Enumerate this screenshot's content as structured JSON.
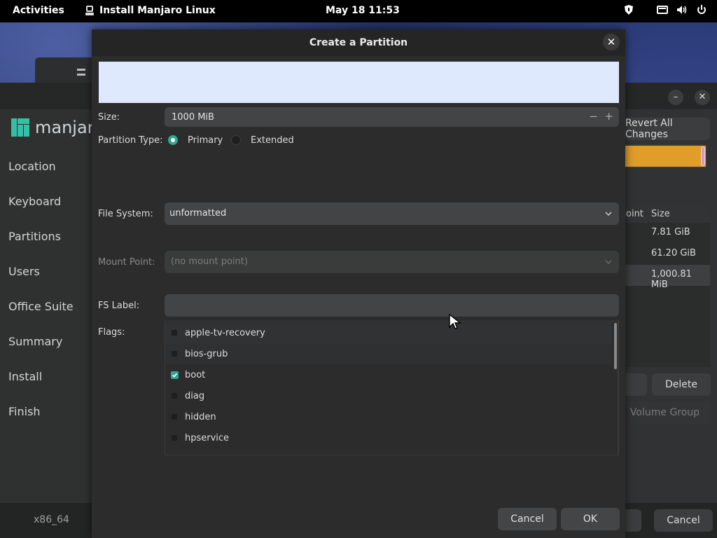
{
  "topbar": {
    "activities": "Activities",
    "app_name": "Install Manjaro Linux",
    "clock": "May 18  11:53"
  },
  "installer": {
    "logo_text": "manjaro",
    "nav": [
      "Location",
      "Keyboard",
      "Partitions",
      "Users",
      "Office Suite",
      "Summary",
      "Install",
      "Finish"
    ],
    "revert_label": "Revert All Changes",
    "table_headers": [
      "oint",
      "Size"
    ],
    "table_sizes": [
      "7.81 GiB",
      "61.20 GiB",
      "1,000.81 MiB"
    ],
    "delete_label": "Delete",
    "volume_group_label": "Volume Group",
    "cancel_label": "Cancel",
    "arch": "x86_64"
  },
  "dialog": {
    "title": "Create a Partition",
    "size_label": "Size:",
    "size_value": "1000 MiB",
    "partition_type_label": "Partition Type:",
    "primary_label": "Primary",
    "extended_label": "Extended",
    "filesystem_label": "File System:",
    "filesystem_value": "unformatted",
    "mount_label": "Mount Point:",
    "mount_value": "(no mount point)",
    "fslabel_label": "FS Label:",
    "fslabel_value": "",
    "flags_label": "Flags:",
    "flags": [
      {
        "name": "apple-tv-recovery",
        "checked": false
      },
      {
        "name": "bios-grub",
        "checked": false
      },
      {
        "name": "boot",
        "checked": true
      },
      {
        "name": "diag",
        "checked": false
      },
      {
        "name": "hidden",
        "checked": false
      },
      {
        "name": "hpservice",
        "checked": false
      }
    ],
    "cancel_label": "Cancel",
    "ok_label": "OK"
  },
  "colors": {
    "accent": "#2ea88f",
    "partition_bar": "#e09d2a",
    "preview_bg": "#dfe9fd"
  }
}
